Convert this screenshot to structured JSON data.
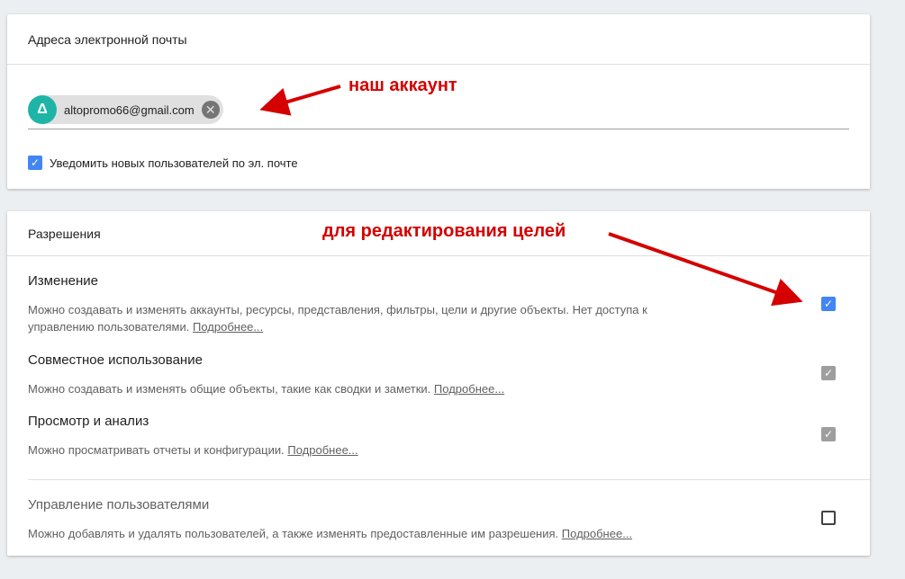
{
  "email_card": {
    "header": "Адреса электронной почты",
    "chip_email": "altopromo66@gmail.com",
    "chip_avatar_letter": "Δ",
    "remove_icon": "close-icon",
    "notify_label": "Уведомить новых пользователей по эл. почте",
    "notify_checked": true
  },
  "perm_card": {
    "header": "Разрешения",
    "items": [
      {
        "title": "Изменение",
        "desc": "Можно создавать и изменять аккаунты, ресурсы, представления, фильтры, цели и другие объекты. Нет доступа к управлению пользователями.",
        "link": "Подробнее...",
        "state": "checked"
      },
      {
        "title": "Совместное использование",
        "desc": "Можно создавать и изменять общие объекты, такие как сводки и заметки.",
        "link": "Подробнее...",
        "state": "checked-disabled"
      },
      {
        "title": "Просмотр и анализ",
        "desc": "Можно просматривать отчеты и конфигурации.",
        "link": "Подробнее...",
        "state": "checked-disabled"
      },
      {
        "title": "Управление пользователями",
        "desc": "Можно добавлять и удалять пользователей, а также изменять предоставленные им разрешения.",
        "link": "Подробнее...",
        "state": "unchecked"
      }
    ]
  },
  "annotations": {
    "account": "наш аккаунт",
    "goals": "для редактирования целей",
    "color": "#d50000"
  },
  "colors": {
    "accent": "#4285f4",
    "chip_avatar": "#1fb5a6"
  }
}
